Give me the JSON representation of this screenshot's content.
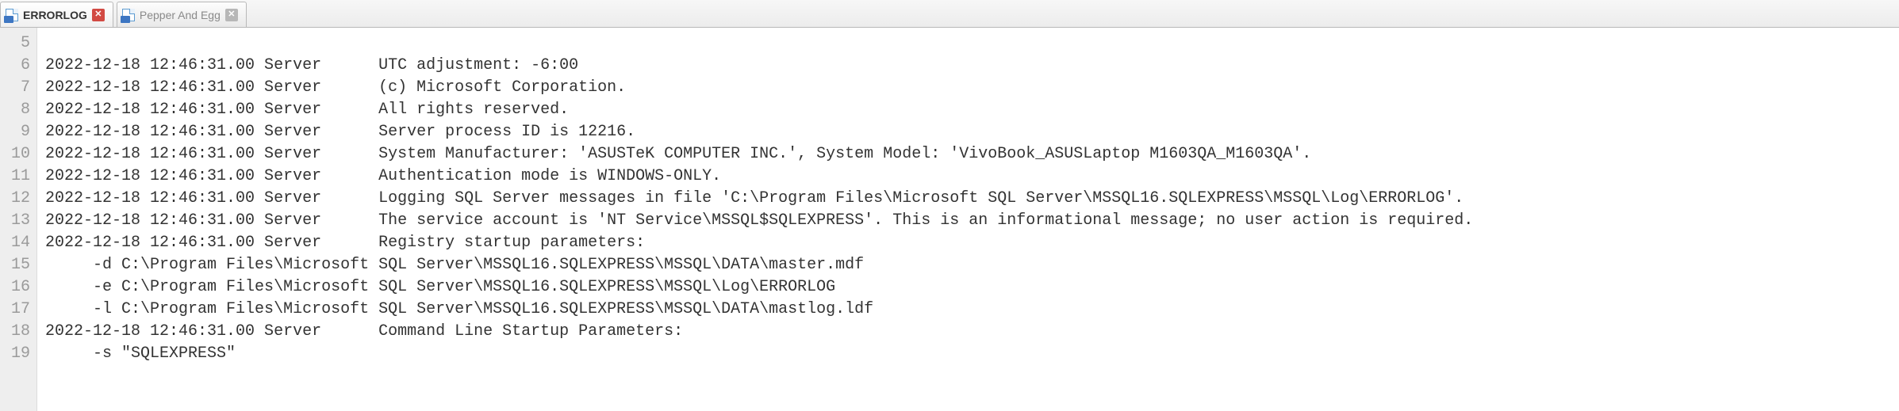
{
  "tabs": [
    {
      "label": "ERRORLOG",
      "active": true
    },
    {
      "label": "Pepper And Egg",
      "active": false
    }
  ],
  "gutter_start": 5,
  "log_lines": [
    "",
    "2022-12-18 12:46:31.00 Server      UTC adjustment: -6:00",
    "2022-12-18 12:46:31.00 Server      (c) Microsoft Corporation.",
    "2022-12-18 12:46:31.00 Server      All rights reserved.",
    "2022-12-18 12:46:31.00 Server      Server process ID is 12216.",
    "2022-12-18 12:46:31.00 Server      System Manufacturer: 'ASUSTeK COMPUTER INC.', System Model: 'VivoBook_ASUSLaptop M1603QA_M1603QA'.",
    "2022-12-18 12:46:31.00 Server      Authentication mode is WINDOWS-ONLY.",
    "2022-12-18 12:46:31.00 Server      Logging SQL Server messages in file 'C:\\Program Files\\Microsoft SQL Server\\MSSQL16.SQLEXPRESS\\MSSQL\\Log\\ERRORLOG'.",
    "2022-12-18 12:46:31.00 Server      The service account is 'NT Service\\MSSQL$SQLEXPRESS'. This is an informational message; no user action is required.",
    "2022-12-18 12:46:31.00 Server      Registry startup parameters:",
    "     -d C:\\Program Files\\Microsoft SQL Server\\MSSQL16.SQLEXPRESS\\MSSQL\\DATA\\master.mdf",
    "     -e C:\\Program Files\\Microsoft SQL Server\\MSSQL16.SQLEXPRESS\\MSSQL\\Log\\ERRORLOG",
    "     -l C:\\Program Files\\Microsoft SQL Server\\MSSQL16.SQLEXPRESS\\MSSQL\\DATA\\mastlog.ldf",
    "2022-12-18 12:46:31.00 Server      Command Line Startup Parameters:",
    "     -s \"SQLEXPRESS\""
  ]
}
